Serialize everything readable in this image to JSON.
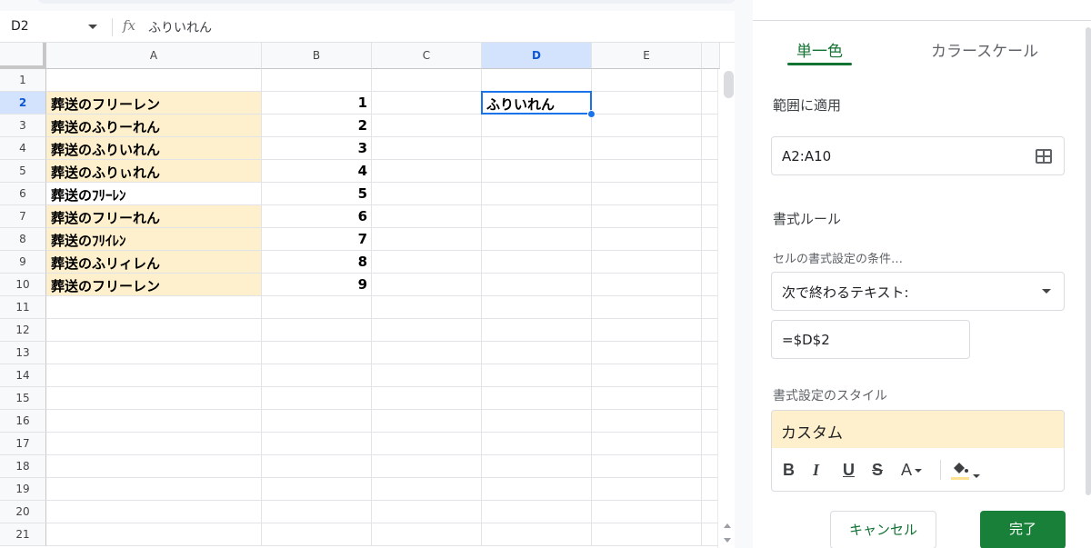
{
  "formula_bar": {
    "name_box": "D2",
    "fx": "fx",
    "content": "ふりいれん"
  },
  "columns": [
    "A",
    "B",
    "C",
    "D",
    "E"
  ],
  "selected_column": "D",
  "rows": [
    {
      "num": "1",
      "a": "",
      "b": "",
      "hl": false
    },
    {
      "num": "2",
      "a": "葬送のフリーレン",
      "b": "1",
      "hl": true
    },
    {
      "num": "3",
      "a": "葬送のふりーれん",
      "b": "2",
      "hl": true
    },
    {
      "num": "4",
      "a": "葬送のふりいれん",
      "b": "3",
      "hl": true
    },
    {
      "num": "5",
      "a": "葬送のふりぃれん",
      "b": "4",
      "hl": true
    },
    {
      "num": "6",
      "a": "葬送のﾌﾘｰﾚﾝ",
      "b": "5",
      "hl": false
    },
    {
      "num": "7",
      "a": "葬送のフリーれん",
      "b": "6",
      "hl": true
    },
    {
      "num": "8",
      "a": "葬送のﾌﾘｲﾚﾝ",
      "b": "7",
      "hl": true
    },
    {
      "num": "9",
      "a": "葬送のふリィレん",
      "b": "8",
      "hl": true
    },
    {
      "num": "10",
      "a": "葬送のフリーレン",
      "b": "9",
      "hl": true
    },
    {
      "num": "11",
      "a": "",
      "b": "",
      "hl": false
    },
    {
      "num": "12",
      "a": "",
      "b": "",
      "hl": false
    },
    {
      "num": "13",
      "a": "",
      "b": "",
      "hl": false
    },
    {
      "num": "14",
      "a": "",
      "b": "",
      "hl": false
    },
    {
      "num": "15",
      "a": "",
      "b": "",
      "hl": false
    },
    {
      "num": "16",
      "a": "",
      "b": "",
      "hl": false
    },
    {
      "num": "17",
      "a": "",
      "b": "",
      "hl": false
    },
    {
      "num": "18",
      "a": "",
      "b": "",
      "hl": false
    },
    {
      "num": "19",
      "a": "",
      "b": "",
      "hl": false
    },
    {
      "num": "20",
      "a": "",
      "b": "",
      "hl": false
    },
    {
      "num": "21",
      "a": "",
      "b": "",
      "hl": false
    }
  ],
  "selected_row": "2",
  "d2_value": "ふりいれん",
  "panel": {
    "tabs": [
      "単一色",
      "カラースケール"
    ],
    "active_tab": "単一色",
    "apply_range_label": "範囲に適用",
    "range_value": "A2:A10",
    "rules_label": "書式ルール",
    "condition_label": "セルの書式設定の条件…",
    "condition_value": "次で終わるテキスト:",
    "condition_input": "=$D$2",
    "style_label": "書式設定のスタイル",
    "style_preview": "カスタム",
    "tools": {
      "bold": "B",
      "italic": "I",
      "underline": "U",
      "strike": "S",
      "text_color": "A"
    },
    "cancel_label": "キャンセル",
    "done_label": "完了"
  },
  "colors": {
    "highlight": "#fef0cd",
    "accent_green": "#137333",
    "selection_blue": "#1a73e8"
  }
}
